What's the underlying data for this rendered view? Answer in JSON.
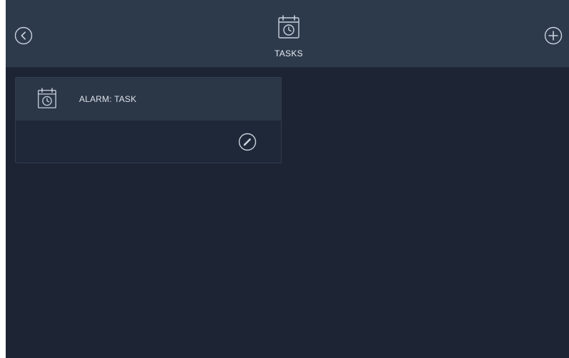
{
  "header": {
    "title": "TASKS",
    "title_icon": "calendar-clock-icon",
    "back_icon": "chevron-left-icon",
    "add_icon": "plus-icon"
  },
  "tasks": [
    {
      "title": "ALARM: TASK",
      "icon": "calendar-clock-icon",
      "edit_icon": "pencil-icon"
    }
  ],
  "colors": {
    "background": "#1d2535",
    "header": "#2d3a4c",
    "card_header": "#2b3647",
    "icon_stroke": "#c9d1dc",
    "text": "#dde3ea"
  }
}
